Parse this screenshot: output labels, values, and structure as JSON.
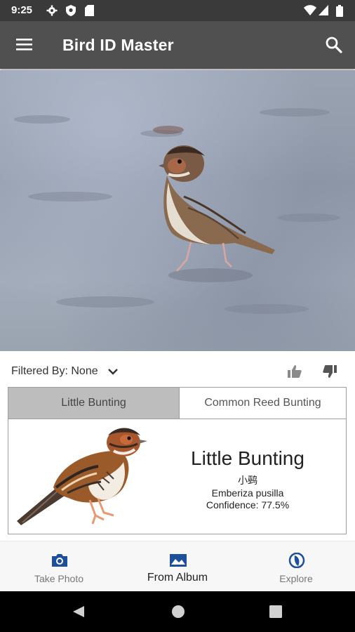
{
  "status_bar": {
    "time": "9:25",
    "icons": [
      "settings-icon",
      "shield-icon",
      "sd-card-icon",
      "wifi-icon",
      "signal-icon",
      "battery-icon"
    ]
  },
  "app_bar": {
    "title": "Bird ID Master",
    "menu_icon": "menu-icon",
    "search_icon": "search-icon",
    "background": "#505050"
  },
  "filter": {
    "label": "Filtered By: None"
  },
  "results": {
    "tabs": [
      {
        "label": "Little Bunting",
        "active": true
      },
      {
        "label": "Common Reed Bunting",
        "active": false
      }
    ],
    "selected": {
      "name": "Little Bunting",
      "chinese_name": "小鹀",
      "scientific_name": "Emberiza pusilla",
      "confidence": "Confidence: 77.5%"
    }
  },
  "bottom_nav": {
    "items": [
      {
        "label": "Take Photo",
        "icon": "camera-icon",
        "active": false
      },
      {
        "label": "From Album",
        "icon": "image-icon",
        "active": true
      },
      {
        "label": "Explore",
        "icon": "explore-icon",
        "active": false
      }
    ],
    "accent": "#1e4f9a"
  },
  "system_nav": {
    "icons": [
      "back-icon",
      "home-icon",
      "recents-icon"
    ]
  }
}
